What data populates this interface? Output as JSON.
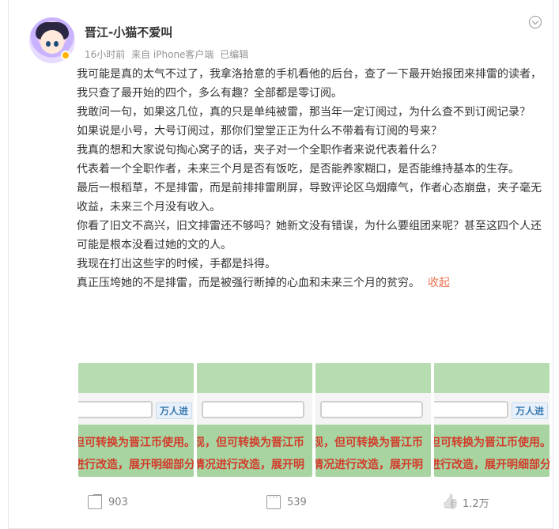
{
  "post": {
    "author": "晋江-小猫不爱叫",
    "time": "16小时前",
    "source": "来自 iPhone客户端",
    "edited": "已编辑",
    "paragraphs": [
      "我可能是真的太气不过了，我拿洛拾意的手机看他的后台，查了一下最开始报团来排雷的读者，我只查了最开始的四个，多么有趣？全部都是零订阅。",
      "我敢问一句，如果这几位，真的只是单纯被雷，那当年一定订阅过，为什么查不到订阅记录？",
      "如果说是小号，大号订阅过，那你们堂堂正正为什么不带着有订阅的号来？",
      "我真的想和大家说句掏心窝子的话，夹子对一个全职作者来说代表着什么？",
      "代表着一个全职作者，未来三个月是否有饭吃，是否能养家糊口，是否能维持基本的生存。",
      "最后一根稻草，不是排雷，而是前排排雷刷屏，导致评论区乌烟瘴气，作者心态崩盘，夹子毫无收益，未来三个月没有收入。",
      "你看了旧文不高兴，旧文排雷还不够吗？她新文没有错误，为什么要组团来呢？甚至这四个人还可能是根本没看过她的文的人。",
      "我现在打出这些字的时候，手都是抖得。",
      "真正压垮她的不是排雷，而是被强行断掉的心血和未来三个月的贫穷。"
    ],
    "collapse_label": "收起"
  },
  "gallery": [
    {
      "tag": "万人进",
      "line1": "但可转换为晋江币使用。",
      "line2": "进行改造，展开明细部分"
    },
    {
      "tag": "",
      "line1": "现，但可转换为晋江币",
      "line2": "情况进行改造，展开明"
    },
    {
      "tag": "",
      "line1": "现，但可转换为晋江币",
      "line2": "情况进行改造，展开明"
    },
    {
      "tag": "万人进",
      "line1": "但可转换为晋江币使用。",
      "line2": "进行改造，展开明细部分"
    }
  ],
  "actions": {
    "share_count": "903",
    "comment_count": "539",
    "like_count": "1.2万"
  },
  "colors": {
    "accent": "#eb7350",
    "thumb_green": "#a7d4a1",
    "thumb_red_text": "#d23c2b"
  }
}
